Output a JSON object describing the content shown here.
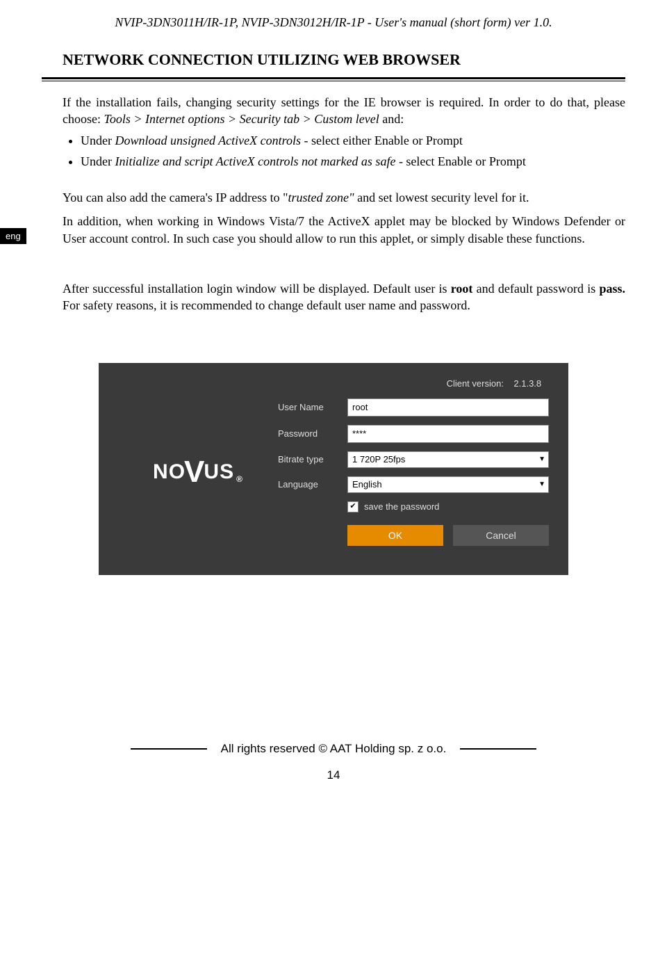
{
  "header": "NVIP-3DN3011H/IR-1P, NVIP-3DN3012H/IR-1P - User's manual (short form) ver 1.0.",
  "sectionTitle": "NETWORK CONNECTION UTILIZING WEB BROWSER",
  "langTab": "eng",
  "para1_a": "If the installation fails, changing security settings for the IE browser is required. In order to do that, please choose: ",
  "para1_i": "Tools > Internet options > Security tab > Custom level ",
  "para1_b": "and:",
  "bullet1_a": "Under ",
  "bullet1_i": "Download unsigned ActiveX controls",
  "bullet1_b": " - select either Enable or Prompt",
  "bullet2_a": "Under ",
  "bullet2_i": "Initialize and script ActiveX controls not marked as safe",
  "bullet2_b": " - select Enable or Prompt",
  "para2_a": "You can also add the camera's IP address to \"",
  "para2_i": "trusted zone\"",
  "para2_b": " and set lowest security level for it.",
  "para3": "In addition, when working in Windows Vista/7 the ActiveX applet may be blocked by Windows Defender or User account control. In such case you should allow to run this applet, or simply disable these functions.",
  "para4_a": "After successful installation login window will be displayed. Default user is ",
  "para4_root": "root",
  "para4_b": " and default password is ",
  "para4_pass": "pass.",
  "para4_c": " For safety reasons, it is recommended to change default user name and password.",
  "login": {
    "clientVersionLabel": "Client version:",
    "clientVersionValue": "2.1.3.8",
    "userNameLabel": "User Name",
    "userNameValue": "root",
    "passwordLabel": "Password",
    "passwordValue": "****",
    "bitrateLabel": "Bitrate type",
    "bitrateValue": "1 720P 25fps",
    "languageLabel": "Language",
    "languageValue": "English",
    "savePasswordLabel": "save the password",
    "savePasswordChecked": "✔",
    "okLabel": "OK",
    "cancelLabel": "Cancel",
    "logoNO": "NO",
    "logoV": "V",
    "logoUS": "US",
    "logoReg": "®"
  },
  "footer": "All rights reserved © AAT Holding sp. z o.o.",
  "pageNumber": "14"
}
